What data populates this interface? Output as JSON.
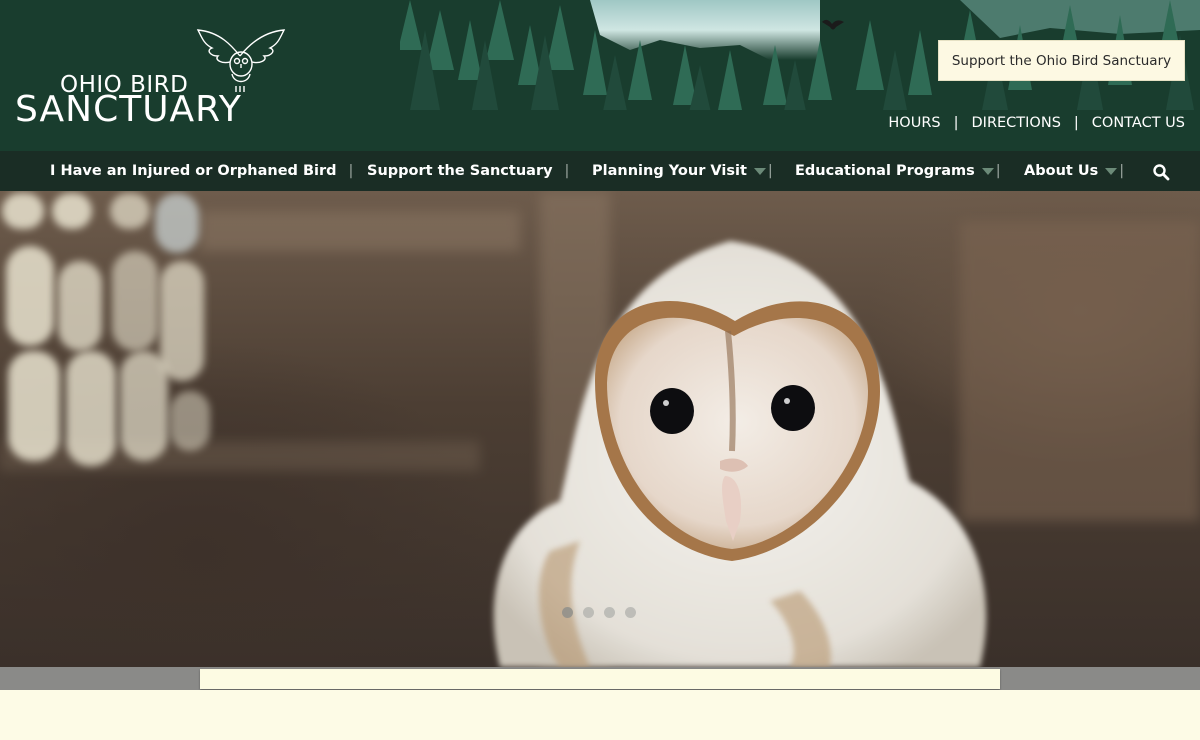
{
  "logo": {
    "line1": "OHIO BIRD",
    "line2": "SANCTUARY"
  },
  "header": {
    "support_button": "Support the Ohio Bird Sanctuary",
    "utility_links": [
      "HOURS",
      "DIRECTIONS",
      "CONTACT US"
    ],
    "separator": "|"
  },
  "nav": {
    "items": [
      {
        "label": "I Have an Injured or Orphaned Bird",
        "has_dropdown": false
      },
      {
        "label": "Support the Sanctuary",
        "has_dropdown": false
      },
      {
        "label": "Planning Your Visit",
        "has_dropdown": true
      },
      {
        "label": "Educational Programs",
        "has_dropdown": true
      },
      {
        "label": "About Us",
        "has_dropdown": true
      }
    ],
    "pipe": "|",
    "search_icon": "search-icon"
  },
  "hero": {
    "image": "baby-barn-owl-photo",
    "slide_count": 4,
    "active_slide": 1
  },
  "colors": {
    "header_bg": "#193d2e",
    "nav_bg": "#1a2d25",
    "cream": "#fdfbe6",
    "caret": "#6b8a78"
  }
}
